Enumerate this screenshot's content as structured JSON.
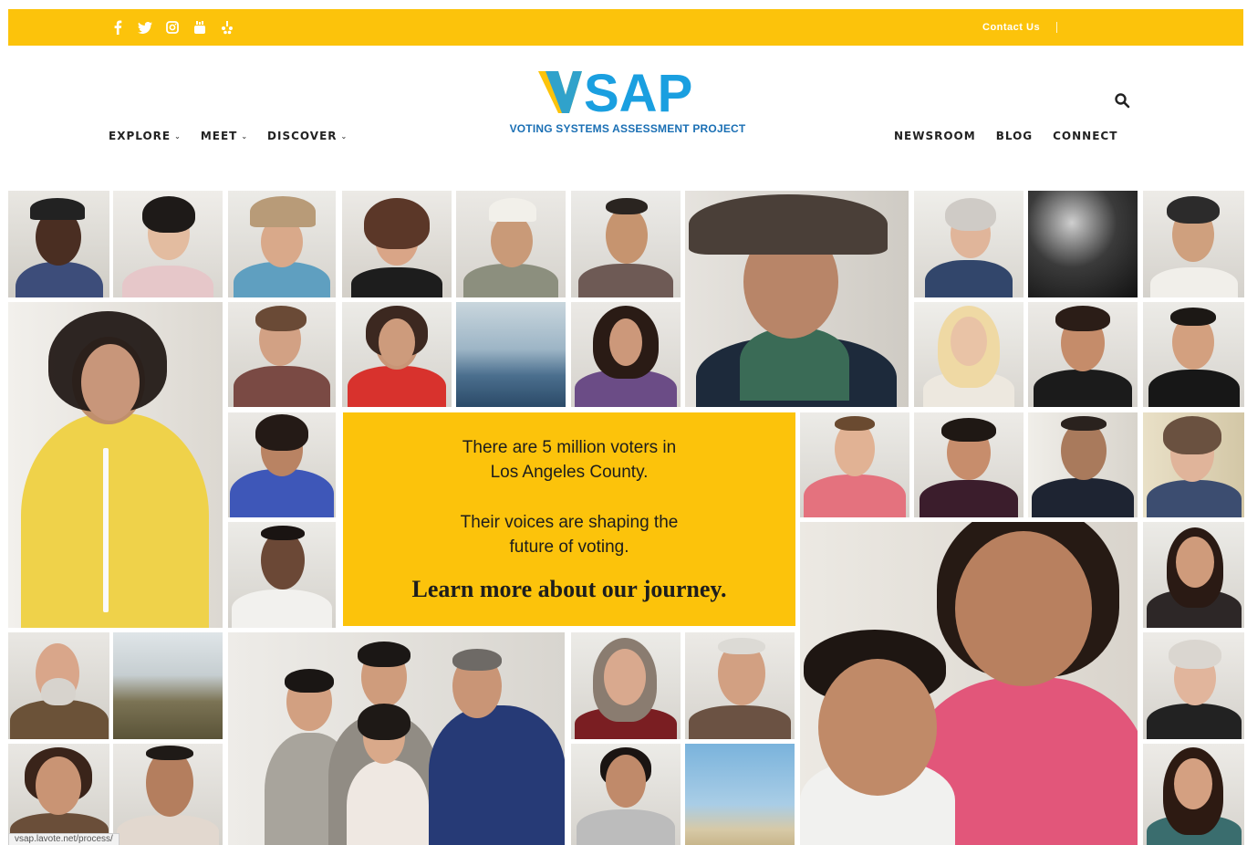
{
  "topbar": {
    "contact_label": "Contact Us",
    "social_icons": [
      "facebook-icon",
      "twitter-icon",
      "instagram-icon",
      "youtube-icon",
      "yelp-icon"
    ],
    "background": "#fcc30b"
  },
  "logo": {
    "wordmark": "VSAP",
    "tagline": "VOTING SYSTEMS ASSESSMENT PROJECT",
    "brand_blue": "#1a9fe0",
    "brand_yellow": "#fcc30b"
  },
  "nav": {
    "left": [
      {
        "label": "EXPLORE",
        "has_dropdown": true
      },
      {
        "label": "MEET",
        "has_dropdown": true
      },
      {
        "label": "DISCOVER",
        "has_dropdown": true
      }
    ],
    "right": [
      {
        "label": "NEWSROOM"
      },
      {
        "label": "BLOG"
      },
      {
        "label": "CONNECT"
      }
    ],
    "chevron": "⌄"
  },
  "message": {
    "line1": "There are 5 million voters in",
    "line2": "Los Angeles County.",
    "line3": "Their voices are shaping the",
    "line4": "future of voting.",
    "cta": "Learn more about our journey."
  },
  "status_url": "vsap.lavote.net/process/"
}
